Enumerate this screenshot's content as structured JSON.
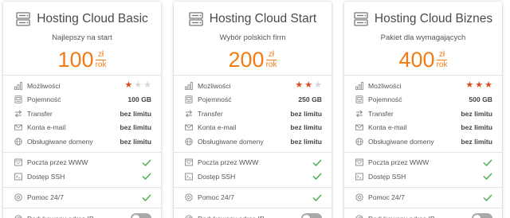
{
  "accent_color": "#f27c14",
  "star_color": "#e04a1b",
  "check_color": "#4caf50",
  "plans": [
    {
      "title": "Hosting Cloud Basic",
      "subtitle": "Najlepszy na start",
      "price": "100",
      "currency": "zł",
      "period": "rok",
      "rating": 1,
      "rating_max": 3,
      "storage": "100 GB",
      "transfer": "bez limitu",
      "emails": "bez limitu",
      "domains": "bez limitu",
      "webmail": true,
      "ssh": true,
      "support": true,
      "dedicated_ip": false
    },
    {
      "title": "Hosting Cloud Start",
      "subtitle": "Wybór polskich firm",
      "price": "200",
      "currency": "zł",
      "period": "rok",
      "rating": 2,
      "rating_max": 3,
      "storage": "250 GB",
      "transfer": "bez limitu",
      "emails": "bez limitu",
      "domains": "bez limitu",
      "webmail": true,
      "ssh": true,
      "support": true,
      "dedicated_ip": false
    },
    {
      "title": "Hosting Cloud Biznes",
      "subtitle": "Pakiet dla wymagających",
      "price": "400",
      "currency": "zł",
      "period": "rok",
      "rating": 3,
      "rating_max": 3,
      "storage": "500 GB",
      "transfer": "bez limitu",
      "emails": "bez limitu",
      "domains": "bez limitu",
      "webmail": true,
      "ssh": true,
      "support": true,
      "dedicated_ip": false
    }
  ],
  "labels": {
    "capabilities": "Możliwości",
    "storage": "Pojemność",
    "transfer": "Transfer",
    "emails": "Konta e-mail",
    "domains": "Obsługiwane domeny",
    "webmail": "Poczta przez WWW",
    "ssh": "Dostęp SSH",
    "support": "Pomoc 24/7",
    "dedicated_ip": "Dedykowany adres IP"
  },
  "icons": {
    "title": "server-icon",
    "capabilities": "bar-chart-icon",
    "storage": "database-icon",
    "transfer": "transfer-icon",
    "emails": "envelope-icon",
    "domains": "globe-icon",
    "webmail": "browser-icon",
    "ssh": "terminal-icon",
    "support": "support-icon",
    "dedicated_ip": "ip-icon"
  }
}
